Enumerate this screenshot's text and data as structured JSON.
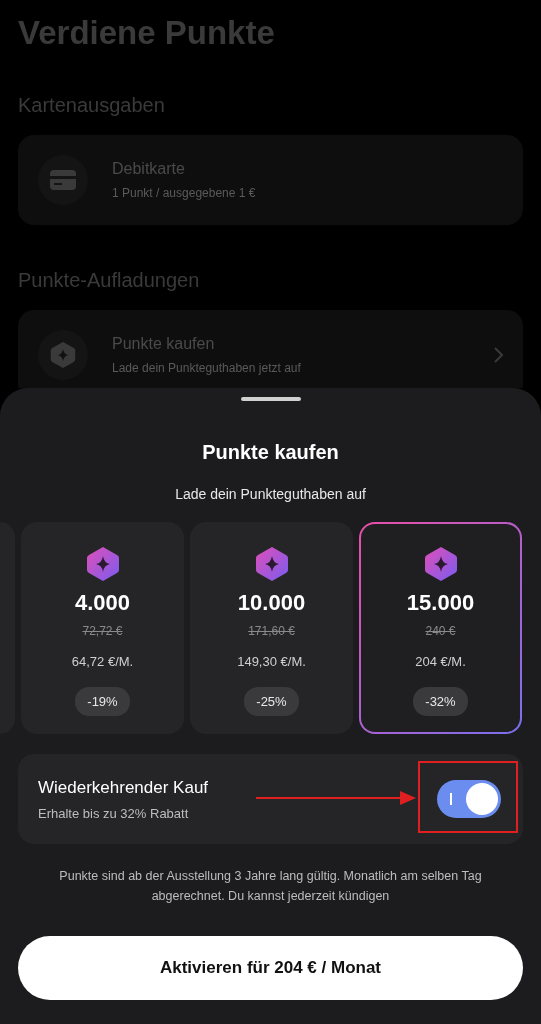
{
  "background": {
    "title": "Verdiene Punkte",
    "sections": [
      {
        "heading": "Kartenausgaben",
        "item": {
          "kind": "card",
          "title": "Debitkarte",
          "subtitle": "1 Punkt / ausgegebene 1 €"
        }
      },
      {
        "heading": "Punkte-Aufladungen",
        "item": {
          "kind": "points",
          "title": "Punkte kaufen",
          "subtitle": "Lade dein Punkteguthaben jetzt auf"
        }
      }
    ]
  },
  "sheet": {
    "title": "Punkte kaufen",
    "subtitle": "Lade dein Punkteguthaben auf",
    "offers": [
      {
        "points": "4.000",
        "old_price": "72,72 €",
        "price": "64,72 €/M.",
        "discount": "-19%",
        "selected": false
      },
      {
        "points": "10.000",
        "old_price": "171,60 €",
        "price": "149,30 €/M.",
        "discount": "-25%",
        "selected": false
      },
      {
        "points": "15.000",
        "old_price": "240 €",
        "price": "204 €/M.",
        "discount": "-32%",
        "selected": true
      }
    ],
    "recurring": {
      "title": "Wiederkehrender Kauf",
      "subtitle": "Erhalte bis zu 32% Rabatt",
      "on": true
    },
    "note": "Punkte sind ab der Ausstellung 3 Jahre lang gültig. Monatlich am selben Tag abgerechnet. Du kannst jederzeit kündigen",
    "button": "Aktivieren für 204 € / Monat"
  }
}
